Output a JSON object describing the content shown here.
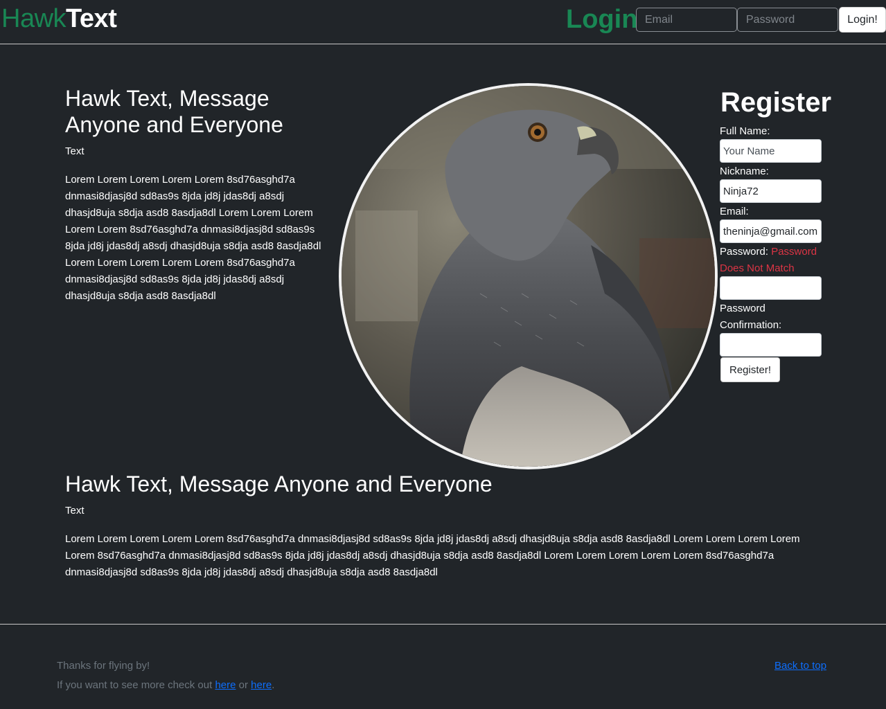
{
  "navbar": {
    "brand_part1": "Hawk",
    "brand_part2": "Text",
    "login_title": "Login",
    "email_placeholder": "Email",
    "password_placeholder": "Password",
    "login_button": "Login!"
  },
  "hero": {
    "title": "Hawk Text, Message Anyone and Everyone",
    "subtitle": "Text",
    "body": "Lorem Lorem Lorem Lorem Lorem 8sd76asghd7a dnmasi8djasj8d sd8as9s 8jda jd8j jdas8dj a8sdj dhasjd8uja s8dja asd8 8asdja8dl Lorem Lorem Lorem Lorem Lorem 8sd76asghd7a dnmasi8djasj8d sd8as9s 8jda jd8j jdas8dj a8sdj dhasjd8uja s8dja asd8 8asdja8dl Lorem Lorem Lorem Lorem Lorem 8sd76asghd7a dnmasi8djasj8d sd8as9s 8jda jd8j jdas8dj a8sdj dhasjd8uja s8dja asd8 8asdja8dl",
    "image_icon": "hawk-photo"
  },
  "register": {
    "title": "Register",
    "full_name_label": "Full Name:",
    "full_name_placeholder": "Your Name",
    "nickname_label": "Nickname:",
    "nickname_value": "Ninja72",
    "email_label": "Email:",
    "email_value": "theninja@gmail.com",
    "password_label": "Password:",
    "password_error": "Password Does Not Match",
    "password_value": "",
    "password_confirmation_label": "Password Confirmation:",
    "password_confirmation_value": "",
    "register_button": "Register!"
  },
  "section2": {
    "title": "Hawk Text, Message Anyone and Everyone",
    "subtitle": "Text",
    "body": "Lorem Lorem Lorem Lorem Lorem 8sd76asghd7a dnmasi8djasj8d sd8as9s 8jda jd8j jdas8dj a8sdj dhasjd8uja s8dja asd8 8asdja8dl Lorem Lorem Lorem Lorem Lorem 8sd76asghd7a dnmasi8djasj8d sd8as9s 8jda jd8j jdas8dj a8sdj dhasjd8uja s8dja asd8 8asdja8dl Lorem Lorem Lorem Lorem Lorem 8sd76asghd7a dnmasi8djasj8d sd8as9s 8jda jd8j jdas8dj a8sdj dhasjd8uja s8dja asd8 8asdja8dl"
  },
  "footer": {
    "thanks": "Thanks for flying by!",
    "more_prefix": "If you want to see more check out ",
    "link1": "here",
    "or_text": " or ",
    "link2": "here",
    "period": ".",
    "back_to_top": "Back to top"
  },
  "colors": {
    "background": "#212529",
    "brand_green": "#198754",
    "error_red": "#dc3545",
    "link_blue": "#0d6efd",
    "muted": "#6c757d"
  }
}
